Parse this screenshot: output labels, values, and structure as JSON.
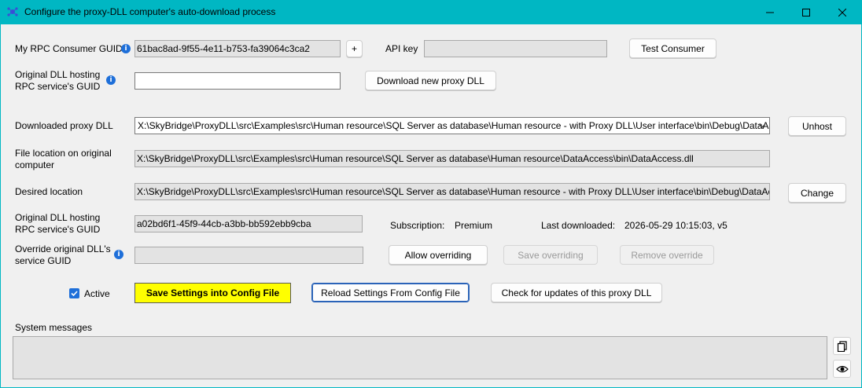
{
  "window": {
    "title": "Configure the proxy-DLL computer's auto-download process",
    "controls": [
      "minimize",
      "maximize",
      "close"
    ]
  },
  "consumer": {
    "guid_label": "My RPC Consumer GUID",
    "guid_value": "61bac8ad-9f55-4e11-b753-fa39064c3ca2",
    "plus_label": "+",
    "api_key_label": "API key",
    "api_key_value": "",
    "test_button": "Test Consumer"
  },
  "original_dll": {
    "label_line1": "Original DLL hosting",
    "label_line2": "RPC service's GUID",
    "input_value": "",
    "download_button": "Download new proxy DLL"
  },
  "downloaded": {
    "label": "Downloaded proxy DLL",
    "selected": "X:\\SkyBridge\\ProxyDLL\\src\\Examples\\src\\Human resource\\SQL Server as database\\Human resource - with Proxy DLL\\User interface\\bin\\Debug\\DataAccess.dll",
    "unhost_button": "Unhost"
  },
  "file_location": {
    "label_line1": "File location on original",
    "label_line2": "computer",
    "value": "X:\\SkyBridge\\ProxyDLL\\src\\Examples\\src\\Human resource\\SQL Server as database\\Human resource\\DataAccess\\bin\\DataAccess.dll"
  },
  "desired": {
    "label": "Desired location",
    "value": "X:\\SkyBridge\\ProxyDLL\\src\\Examples\\src\\Human resource\\SQL Server as database\\Human resource - with Proxy DLL\\User interface\\bin\\Debug\\DataAccess.dll",
    "change_button": "Change"
  },
  "hosting": {
    "label_line1": "Original DLL hosting",
    "label_line2": "RPC service's GUID",
    "value": "a02bd6f1-45f9-44cb-a3bb-bb592ebb9cba",
    "subscription_label": "Subscription:",
    "subscription_value": "Premium",
    "last_downloaded_label": "Last downloaded:",
    "last_downloaded_value": "2026-05-29 10:15:03, v5"
  },
  "override": {
    "label_line1": "Override original DLL's",
    "label_line2": "service GUID",
    "value": "",
    "allow_button": "Allow overriding",
    "save_button": "Save overriding",
    "remove_button": "Remove override"
  },
  "actions": {
    "active_label": "Active",
    "active_checked": true,
    "save_config": "Save Settings into Config File",
    "reload_config": "Reload Settings From Config File",
    "check_updates": "Check for updates of this proxy DLL"
  },
  "system": {
    "label": "System messages",
    "messages": ""
  },
  "colors": {
    "titlebar": "#00b7c3",
    "accent": "#1e6fd9",
    "save_highlight": "#ffff00"
  },
  "icons": [
    "app-icon",
    "minimize-icon",
    "maximize-icon",
    "close-icon",
    "info-icon",
    "chevron-down-icon",
    "checkmark-icon",
    "copy-icon",
    "eye-icon"
  ]
}
